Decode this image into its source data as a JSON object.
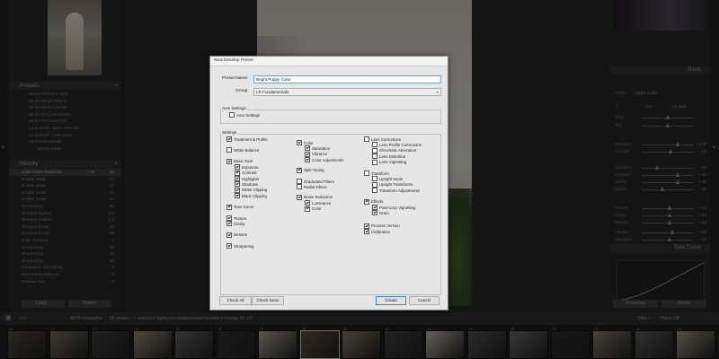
{
  "presets_panel": {
    "title": "Presets",
    "items": [
      "00-00 PROFILE DEX",
      "00-01 VFLO TOOLS",
      "00-02 VFLO CHLOR",
      "00-03 VFLO MODERN",
      "00-04 VFLO PASTEL",
      "Loupedeck - Basic Haircrop",
      "Loupedeck - Luke Mots",
      "LR Fundamentals"
    ],
    "sub_item": "Moody B&W"
  },
  "history_panel": {
    "title": "History",
    "items": [
      {
        "label": "Color Noise Reduction",
        "value": "+16",
        "value2": "16"
      },
      {
        "label": "Enable Detail",
        "value": "",
        "value2": "On"
      },
      {
        "label": "Enable Detail",
        "value": "",
        "value2": "On"
      },
      {
        "label": "Enable Detail",
        "value": "",
        "value2": "On"
      },
      {
        "label": "Enable Detail",
        "value": "",
        "value2": "On"
      },
      {
        "label": "Sharpening",
        "value": "",
        "value2": "30"
      },
      {
        "label": "Sharpen Radius",
        "value": "",
        "value2": "1.0"
      },
      {
        "label": "Sharpen Radius",
        "value": "",
        "value2": "1.0"
      },
      {
        "label": "Sharpen Detail",
        "value": "",
        "value2": "25"
      },
      {
        "label": "Sharpen Detail",
        "value": "",
        "value2": "25"
      },
      {
        "label": "Edge Masking",
        "value": "",
        "value2": "0"
      },
      {
        "label": "Sharpening",
        "value": "",
        "value2": "40"
      },
      {
        "label": "Sharpening",
        "value": "",
        "value2": "40"
      },
      {
        "label": "Sharpening",
        "value": "",
        "value2": "40"
      },
      {
        "label": "Luminance Smoothing",
        "value": "",
        "value2": "0"
      },
      {
        "label": "Split Toning Balance",
        "value": "",
        "value2": "0"
      },
      {
        "label": "Shadow Hue",
        "value": "",
        "value2": "0"
      }
    ],
    "copy_label": "Copy...",
    "paste_label": "Paste"
  },
  "right_panel": {
    "basic_title": "Basic",
    "tone_curve_title": "Tone Curve",
    "profile_label": "Profile :",
    "profile_value": "Adobe Color",
    "wb_label": "WB :",
    "wb_value": "As Shot",
    "sliders": [
      {
        "label": "Temp",
        "value": "",
        "pos": 0.5
      },
      {
        "label": "Tint",
        "value": "",
        "pos": 0.5
      },
      {
        "label": "Exposure",
        "value": "+ 1.30",
        "pos": 0.7
      },
      {
        "label": "Contrast",
        "value": "+ 15",
        "pos": 0.56
      },
      {
        "label": "Highlights",
        "value": "- 60",
        "pos": 0.3
      },
      {
        "label": "Shadows",
        "value": "+ 40",
        "pos": 0.7
      },
      {
        "label": "Whites",
        "value": "+ 40",
        "pos": 0.7
      },
      {
        "label": "Blacks",
        "value": "- 20",
        "pos": 0.4
      },
      {
        "label": "Texture",
        "value": "+ 10",
        "pos": 0.55
      },
      {
        "label": "Clarity",
        "value": "+ 10",
        "pos": 0.55
      },
      {
        "label": "Dehaze",
        "value": "+ 10",
        "pos": 0.55
      },
      {
        "label": "Vibrance",
        "value": "+ 20",
        "pos": 0.6
      },
      {
        "label": "Saturation",
        "value": "+ 10",
        "pos": 0.55
      }
    ],
    "previous_label": "Previous",
    "reset_label": "Reset"
  },
  "toolbar": {
    "source": "All Photographs",
    "count": "66 photos / 1 selected / lightroom-fundamental-tutorials-lr-lounge-26.cr2",
    "filter_label": "Filter :",
    "filter_value": "Filters Off"
  },
  "filmstrip": {
    "numbers": [
      "26",
      "27",
      "28",
      "29",
      "30",
      "31",
      "32",
      "33",
      "34",
      "35",
      "36",
      "37",
      "38",
      "39",
      "40",
      "41",
      "42"
    ]
  },
  "dialog": {
    "title": "New Develop Preset",
    "preset_name_label": "Preset Name:",
    "preset_name_value": "Bright Poppy Color",
    "group_label": "Group:",
    "group_value": "LR Fundamentals",
    "auto_settings_group": "Auto Settings",
    "auto_settings_item": "Auto Settings",
    "settings_group": "Settings",
    "col1": [
      {
        "label": "Treatment & Profile",
        "checked": true,
        "indent": 0
      },
      {
        "label": "White Balance",
        "checked": false,
        "indent": 0
      },
      {
        "label": "Basic Tone",
        "checked": true,
        "indent": 0
      },
      {
        "label": "Exposure",
        "checked": true,
        "indent": 1
      },
      {
        "label": "Contrast",
        "checked": true,
        "indent": 1
      },
      {
        "label": "Highlights",
        "checked": true,
        "indent": 1
      },
      {
        "label": "Shadows",
        "checked": true,
        "indent": 1
      },
      {
        "label": "White Clipping",
        "checked": true,
        "indent": 1
      },
      {
        "label": "Black Clipping",
        "checked": true,
        "indent": 1
      },
      {
        "label": "Tone Curve",
        "checked": true,
        "indent": 0
      },
      {
        "label": "Texture",
        "checked": true,
        "indent": 0
      },
      {
        "label": "Clarity",
        "checked": true,
        "indent": 0
      },
      {
        "label": "Dehaze",
        "checked": true,
        "indent": 0
      },
      {
        "label": "Sharpening",
        "checked": true,
        "indent": 0
      }
    ],
    "col2": [
      {
        "label": "Color",
        "checked": true,
        "indent": 0
      },
      {
        "label": "Saturation",
        "checked": true,
        "indent": 1
      },
      {
        "label": "Vibrance",
        "checked": true,
        "indent": 1
      },
      {
        "label": "Color Adjustments",
        "checked": true,
        "indent": 1
      },
      {
        "label": "Split Toning",
        "checked": true,
        "indent": 0
      },
      {
        "label": "Graduated Filters",
        "checked": false,
        "indent": 0
      },
      {
        "label": "Radial Filters",
        "checked": false,
        "indent": 0
      },
      {
        "label": "Noise Reduction",
        "checked": true,
        "indent": 0
      },
      {
        "label": "Luminance",
        "checked": true,
        "indent": 1
      },
      {
        "label": "Color",
        "checked": true,
        "indent": 1
      }
    ],
    "col3": [
      {
        "label": "Lens Corrections",
        "checked": false,
        "indent": 0
      },
      {
        "label": "Lens Profile Corrections",
        "checked": false,
        "indent": 1
      },
      {
        "label": "Chromatic Aberration",
        "checked": false,
        "indent": 1
      },
      {
        "label": "Lens Distortion",
        "checked": false,
        "indent": 1
      },
      {
        "label": "Lens Vignetting",
        "checked": false,
        "indent": 1
      },
      {
        "label": "Transform",
        "checked": false,
        "indent": 0
      },
      {
        "label": "Upright Mode",
        "checked": false,
        "indent": 1
      },
      {
        "label": "Upright Transforms",
        "checked": false,
        "indent": 1
      },
      {
        "label": "Transform Adjustments",
        "checked": false,
        "indent": 1
      },
      {
        "label": "Effects",
        "checked": true,
        "indent": 0
      },
      {
        "label": "Post-Crop Vignetting",
        "checked": true,
        "indent": 1
      },
      {
        "label": "Grain",
        "checked": true,
        "indent": 1
      },
      {
        "label": "Process Version",
        "checked": true,
        "indent": 0
      },
      {
        "label": "Calibration",
        "checked": true,
        "indent": 0
      }
    ],
    "check_all_label": "Check All",
    "check_none_label": "Check None",
    "create_label": "Create",
    "cancel_label": "Cancel"
  }
}
